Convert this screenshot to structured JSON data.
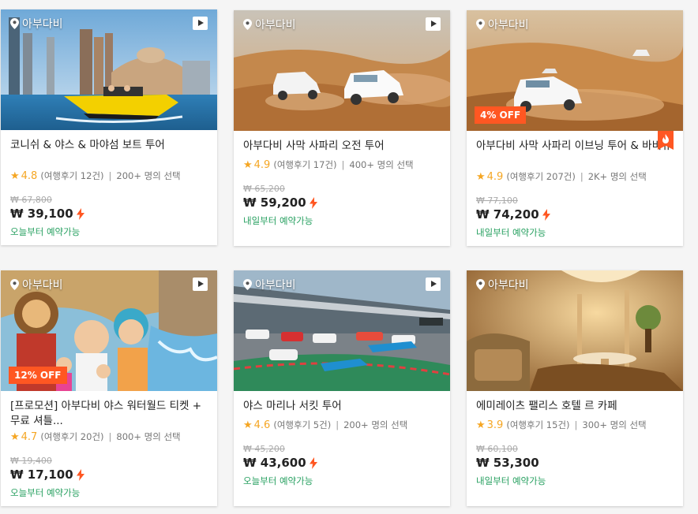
{
  "cards": [
    {
      "location": "아부다비",
      "title": "코니쉬 & 야스 & 마야섬 보트 투어",
      "rating": "4.8",
      "reviews": "(여행후기 12건)",
      "selections": "200+ 명의 선택",
      "original_price": "₩ 67,800",
      "price": "₩ 39,100",
      "availability": "오늘부터 예약가능",
      "discount": "",
      "has_video": true,
      "hot": false
    },
    {
      "location": "아부다비",
      "title": "아부다비 사막 사파리 오전 투어",
      "rating": "4.9",
      "reviews": "(여행후기 17건)",
      "selections": "400+ 명의 선택",
      "original_price": "₩ 65,200",
      "price": "₩ 59,200",
      "availability": "내일부터 예약가능",
      "discount": "",
      "has_video": true,
      "hot": false
    },
    {
      "location": "아부다비",
      "title": "아부다비 사막 사파리 이브닝 투어 & 바비큐",
      "rating": "4.9",
      "reviews": "(여행후기 207건)",
      "selections": "2K+ 명의 선택",
      "original_price": "₩ 77,100",
      "price": "₩ 74,200",
      "availability": "내일부터 예약가능",
      "discount": "4% OFF",
      "has_video": false,
      "hot": true
    },
    {
      "location": "아부다비",
      "title": "[프로모션] 아부다비 야스 워터월드 티켓 + 무료 셔틀...",
      "rating": "4.7",
      "reviews": "(여행후기 20건)",
      "selections": "800+ 명의 선택",
      "original_price": "₩ 19,400",
      "price": "₩ 17,100",
      "availability": "오늘부터 예약가능",
      "discount": "12% OFF",
      "has_video": true,
      "hot": false
    },
    {
      "location": "아부다비",
      "title": "야스 마리나 서킷 투어",
      "rating": "4.6",
      "reviews": "(여행후기 5건)",
      "selections": "200+ 명의 선택",
      "original_price": "₩ 45,200",
      "price": "₩ 43,600",
      "availability": "오늘부터 예약가능",
      "discount": "",
      "has_video": true,
      "hot": false
    },
    {
      "location": "아부다비",
      "title": "에미레이츠 팰리스 호텔 르 카페",
      "rating": "3.9",
      "reviews": "(여행후기 15건)",
      "selections": "300+ 명의 선택",
      "original_price": "₩ 60,100",
      "price": "₩ 53,300",
      "availability": "내일부터 예약가능",
      "discount": "",
      "has_video": false,
      "hot": false
    }
  ],
  "colors": {
    "accent": "#ff5722",
    "star": "#f5a623",
    "availability": "#27a060"
  }
}
